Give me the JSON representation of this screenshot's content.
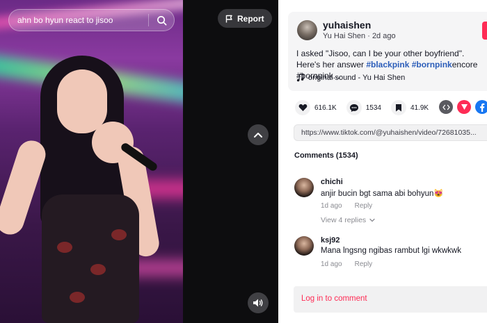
{
  "search": {
    "query": "ahn bo hyun react to jisoo"
  },
  "video": {
    "report_label": "Report"
  },
  "author": {
    "username": "yuhaishen",
    "display_name": "Yu Hai Shen",
    "time": "2d ago"
  },
  "description": {
    "text": "I asked \"Jisoo, can I be your other boyfriend\". Here's her answer ",
    "tag1": "#blackpink",
    "tag2": "#bornpink",
    "rest": "encore #bornpink..."
  },
  "sound": {
    "label": "original sound - Yu Hai Shen"
  },
  "actions": {
    "likes": "616.1K",
    "comments": "1534",
    "saves": "41.9K"
  },
  "colors": {
    "accent": "#fe2c55",
    "hashtag": "#2b5db9",
    "panel_bg": "#f5f5f6"
  },
  "link": {
    "url": "https://www.tiktok.com/@yuhaishen/video/72681035..."
  },
  "comments_section": {
    "title": "Comments (1534)",
    "items": [
      {
        "user": "chichi",
        "text": "anjir bucin bgt sama abi bohyun😻",
        "time": "1d ago",
        "reply": "Reply",
        "replies": "View 4 replies"
      },
      {
        "user": "ksj92",
        "text": "Mana lngsng ngibas rambut lgi wkwkwk",
        "time": "1d ago",
        "reply": "Reply"
      }
    ]
  },
  "login": {
    "label": "Log in to comment"
  }
}
